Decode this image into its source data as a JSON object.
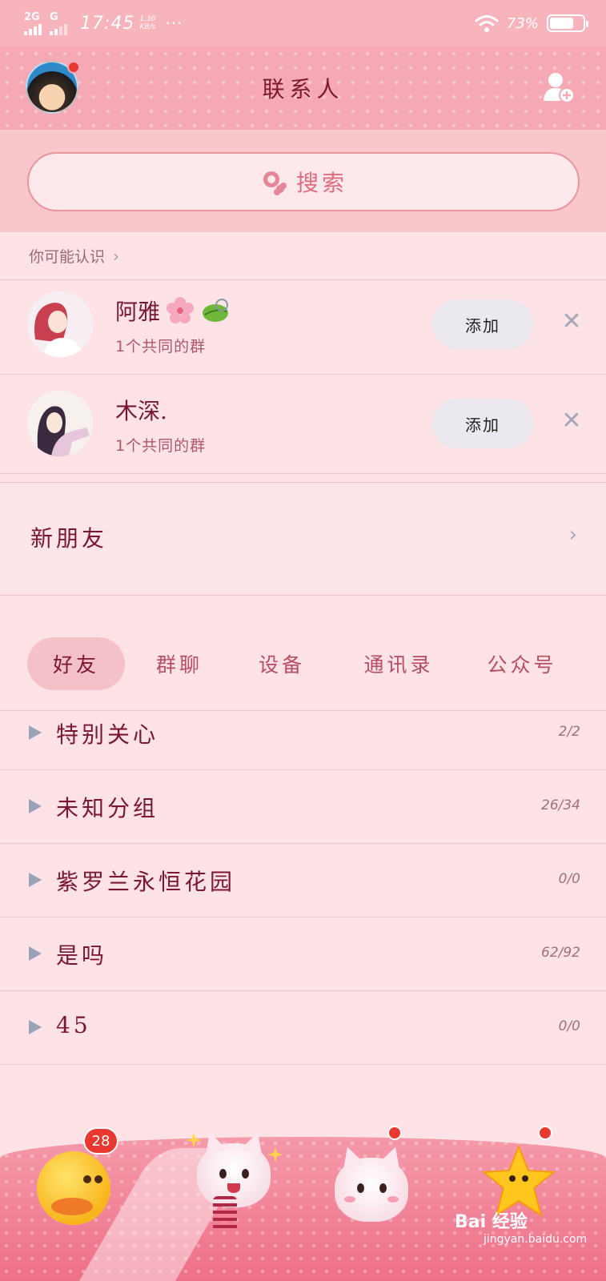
{
  "status_bar": {
    "signal1_label": "2G",
    "signal2_label": "G",
    "time": "17:45",
    "speed_value": "1.30",
    "speed_unit": "KB/s",
    "dots": "···",
    "battery_pct": "73%",
    "battery_level": 0.73
  },
  "header": {
    "title": "联系人",
    "avatar_has_notification": true
  },
  "search": {
    "placeholder": "搜索"
  },
  "maybe_know": {
    "title": "你可能认识",
    "people": [
      {
        "name": "阿雅",
        "mutual": "1个共同的群",
        "add_label": "添加"
      },
      {
        "name": "木深.",
        "mutual": "1个共同的群",
        "add_label": "添加"
      }
    ]
  },
  "new_friends": {
    "label": "新朋友"
  },
  "tabs": [
    {
      "label": "好友",
      "active": true
    },
    {
      "label": "群聊",
      "active": false
    },
    {
      "label": "设备",
      "active": false
    },
    {
      "label": "通讯录",
      "active": false
    },
    {
      "label": "公众号",
      "active": false
    }
  ],
  "groups": [
    {
      "name": "特别关心",
      "count": "2/2"
    },
    {
      "name": "未知分组",
      "count": "26/34"
    },
    {
      "name": "紫罗兰永恒花园",
      "count": "0/0"
    },
    {
      "name": "是吗",
      "count": "62/92"
    },
    {
      "name": "45",
      "count": "0/0"
    }
  ],
  "bottom_nav": {
    "messages_badge": "28",
    "items": [
      "messages-duck-icon",
      "contacts-cat-icon",
      "discover-cat-icon",
      "star-icon"
    ]
  },
  "watermark": {
    "brand": "Bai 经验",
    "url": "jingyan.baidu.com"
  },
  "colors": {
    "header_bg": "#f6a9b5",
    "page_bg": "#fde3e6",
    "text_primary": "#7a1630",
    "badge": "#e8382f"
  }
}
